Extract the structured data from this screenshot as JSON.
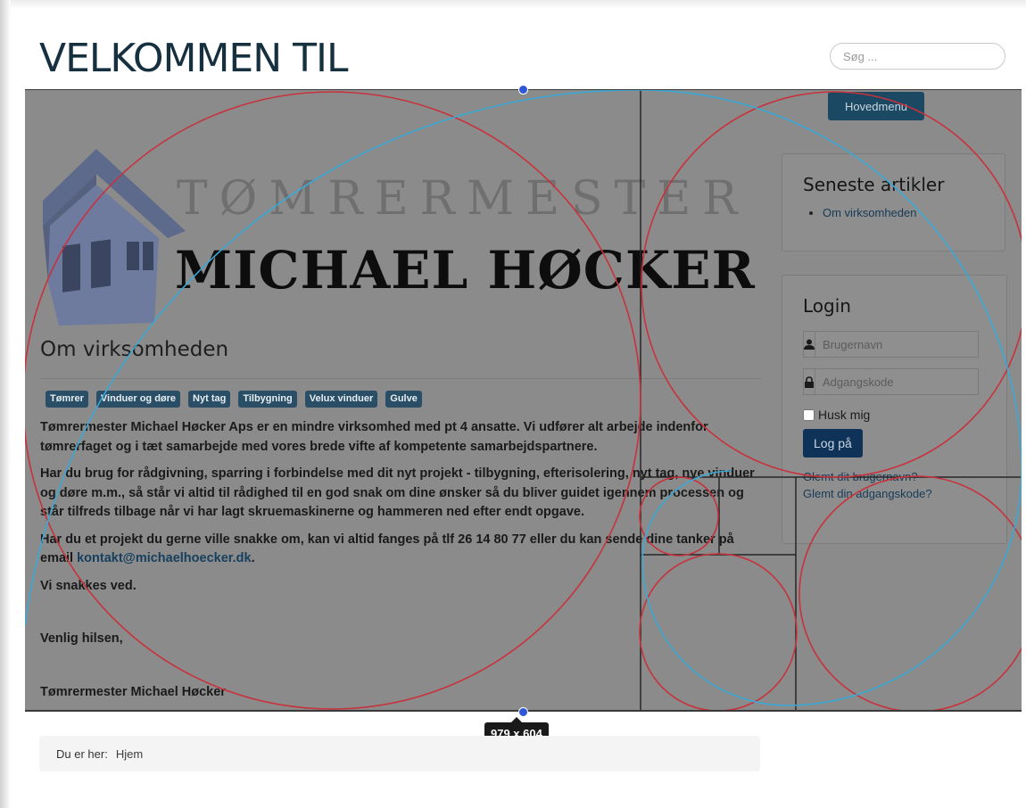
{
  "header": {
    "title": "VELKOMMEN TIL",
    "search_placeholder": "Søg ..."
  },
  "logo": {
    "line1": "TØMRERMESTER",
    "line2": "MICHAEL HØCKER"
  },
  "article": {
    "title": "Om virksomheden",
    "tags": [
      "Tømrer",
      "Vinduer og døre",
      "Nyt tag",
      "Tilbygning",
      "Velux vinduer",
      "Gulve"
    ],
    "p1": "Tømrermester Michael Høcker Aps er en mindre virksomhed med pt 4 ansatte. Vi udfører alt arbejde indenfor tømrerfaget og i tæt samarbejde med vores brede vifte af kompetente samarbejdspartnere.",
    "p2": "Har du brug for rådgivning, sparring i forbindelse med dit nyt projekt - tilbygning, efterisolering, nyt tag, nye vinduer og døre m.m., så står vi altid til rådighed til en god snak om dine ønsker så du bliver guidet igennem processen og står tilfreds tilbage når vi har lagt skruemaskinerne og hammeren ned efter endt opgave.",
    "p3_before": "Har du et projekt du gerne ville snakke om, kan vi altid fanges på tlf 26 14 80 77 eller du kan sende dine tanker på email ",
    "p3_email": "kontakt@michaelhoecker.dk",
    "p3_after": ".",
    "p4": "Vi snakkes ved.",
    "p5": "Venlig hilsen,",
    "p6": "Tømrermester Michael Høcker"
  },
  "sidebar": {
    "menu_button": "Hovedmenu",
    "latest": {
      "title": "Seneste artikler",
      "items": [
        "Om virksomheden"
      ]
    },
    "login": {
      "title": "Login",
      "username_placeholder": "Brugernavn",
      "password_placeholder": "Adgangskode",
      "remember_label": "Husk mig",
      "submit_label": "Log på",
      "forgot_username": "Glemt dit brugernavn?",
      "forgot_password": "Glemt din adgangskode?"
    }
  },
  "overlay": {
    "dimensions_label": "979 x 604",
    "red_circle_color": "#c8323c",
    "blue_arc_color": "#3aa9d6",
    "grid_line_color": "#262626",
    "handle_color": "#2f56d9"
  },
  "breadcrumb": {
    "label": "Du er her:",
    "current": "Hjem"
  }
}
